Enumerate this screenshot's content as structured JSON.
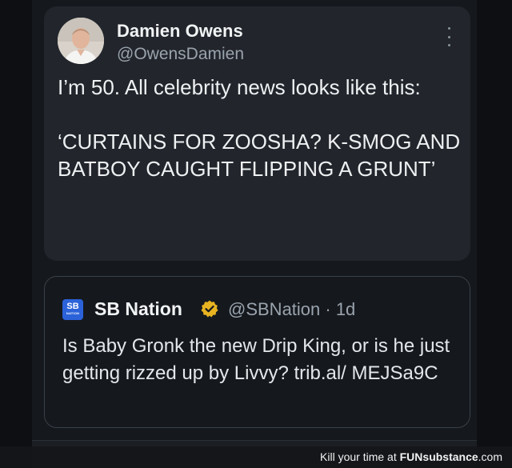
{
  "tweet": {
    "author_name": "Damien Owens",
    "author_handle": "@OwensDamien",
    "text": "I’m 50. All celebrity news looks like this:\n\n‘CURTAINS FOR ZOOSHA? K-SMOG AND BATBOY CAUGHT FLIPPING A GRUNT’",
    "more_icon": "more-vertical-icon"
  },
  "quote": {
    "logo_text": "SB",
    "logo_subtext": "NATION",
    "author_name": "SB Nation",
    "verified_icon": "verified-badge-icon",
    "verified_color": "#e8b321",
    "meta": "@SBNation · 1d",
    "text": "Is Baby Gronk the new Drip King, or is he just getting rizzed up by Livvy? trib.al/ MEJSa9C"
  },
  "watermark": {
    "prefix": "Kill your time at ",
    "brand_part1": "FUN",
    "brand_part2": "substance",
    "brand_part3": ".com"
  }
}
